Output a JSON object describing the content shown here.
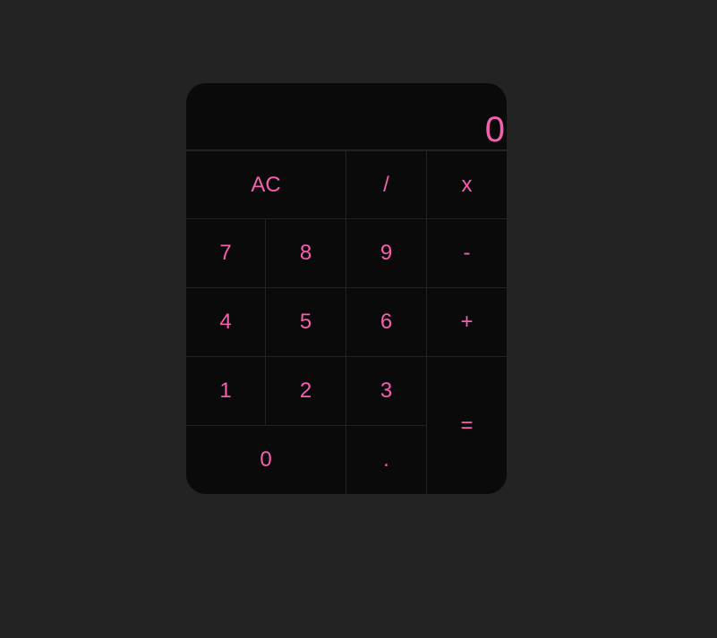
{
  "display": {
    "value": "0"
  },
  "colors": {
    "page_background": "#232323",
    "calculator_background": "#0a0a0a",
    "accent": "#f55fb0",
    "divider": "#222222"
  },
  "keys": {
    "clear": "AC",
    "divide": "/",
    "multiply": "x",
    "seven": "7",
    "eight": "8",
    "nine": "9",
    "subtract": "-",
    "four": "4",
    "five": "5",
    "six": "6",
    "add": "+",
    "one": "1",
    "two": "2",
    "three": "3",
    "equals": "=",
    "zero": "0",
    "decimal": "."
  }
}
